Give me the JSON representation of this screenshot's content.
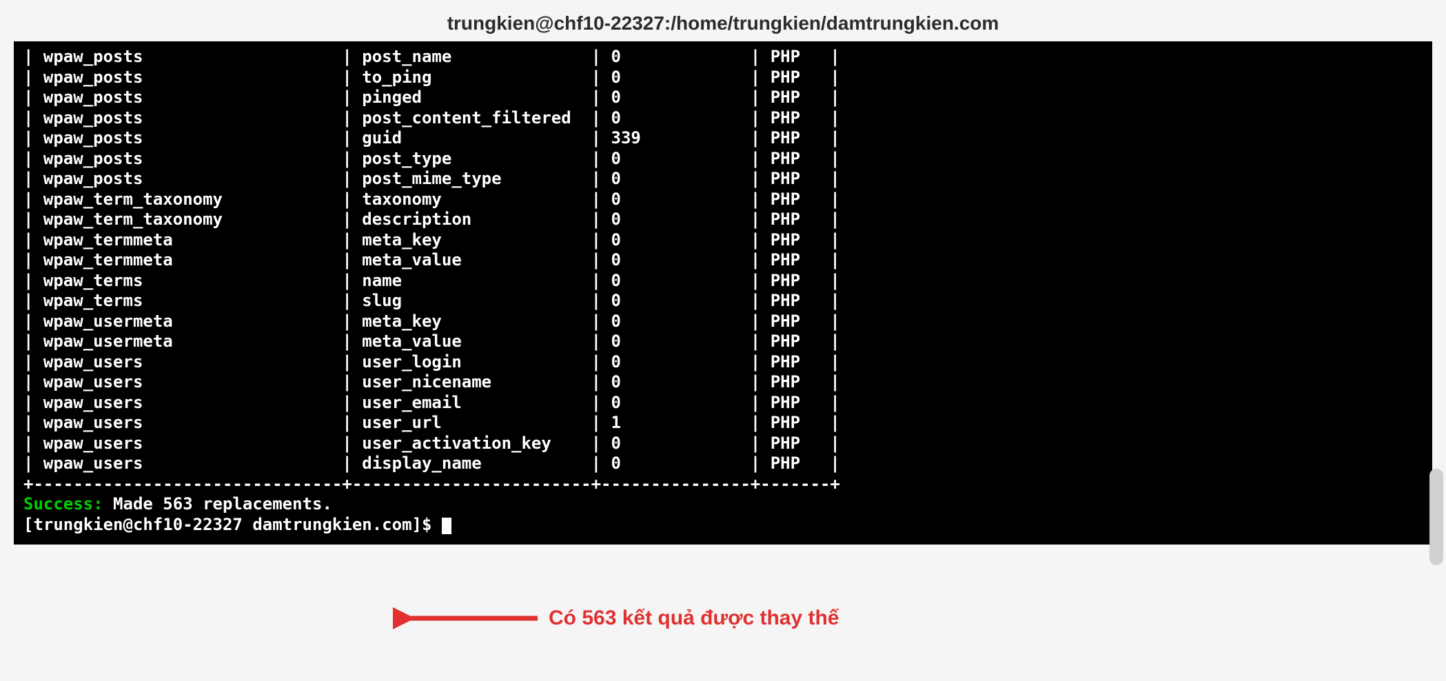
{
  "title": "trungkien@chf10-22327:/home/trungkien/damtrungkien.com",
  "rows": [
    {
      "table": "wpaw_posts",
      "column": "post_name",
      "count": "0",
      "type": "PHP"
    },
    {
      "table": "wpaw_posts",
      "column": "to_ping",
      "count": "0",
      "type": "PHP"
    },
    {
      "table": "wpaw_posts",
      "column": "pinged",
      "count": "0",
      "type": "PHP"
    },
    {
      "table": "wpaw_posts",
      "column": "post_content_filtered",
      "count": "0",
      "type": "PHP"
    },
    {
      "table": "wpaw_posts",
      "column": "guid",
      "count": "339",
      "type": "PHP"
    },
    {
      "table": "wpaw_posts",
      "column": "post_type",
      "count": "0",
      "type": "PHP"
    },
    {
      "table": "wpaw_posts",
      "column": "post_mime_type",
      "count": "0",
      "type": "PHP"
    },
    {
      "table": "wpaw_term_taxonomy",
      "column": "taxonomy",
      "count": "0",
      "type": "PHP"
    },
    {
      "table": "wpaw_term_taxonomy",
      "column": "description",
      "count": "0",
      "type": "PHP"
    },
    {
      "table": "wpaw_termmeta",
      "column": "meta_key",
      "count": "0",
      "type": "PHP"
    },
    {
      "table": "wpaw_termmeta",
      "column": "meta_value",
      "count": "0",
      "type": "PHP"
    },
    {
      "table": "wpaw_terms",
      "column": "name",
      "count": "0",
      "type": "PHP"
    },
    {
      "table": "wpaw_terms",
      "column": "slug",
      "count": "0",
      "type": "PHP"
    },
    {
      "table": "wpaw_usermeta",
      "column": "meta_key",
      "count": "0",
      "type": "PHP"
    },
    {
      "table": "wpaw_usermeta",
      "column": "meta_value",
      "count": "0",
      "type": "PHP"
    },
    {
      "table": "wpaw_users",
      "column": "user_login",
      "count": "0",
      "type": "PHP"
    },
    {
      "table": "wpaw_users",
      "column": "user_nicename",
      "count": "0",
      "type": "PHP"
    },
    {
      "table": "wpaw_users",
      "column": "user_email",
      "count": "0",
      "type": "PHP"
    },
    {
      "table": "wpaw_users",
      "column": "user_url",
      "count": "1",
      "type": "PHP"
    },
    {
      "table": "wpaw_users",
      "column": "user_activation_key",
      "count": "0",
      "type": "PHP"
    },
    {
      "table": "wpaw_users",
      "column": "display_name",
      "count": "0",
      "type": "PHP"
    }
  ],
  "col_widths": {
    "table": 30,
    "column": 23,
    "count": 14,
    "type": 6
  },
  "success_label": "Success:",
  "success_msg": " Made 563 replacements.",
  "prompt": "[trungkien@chf10-22327 damtrungkien.com]$ ",
  "annotation": "Có 563 kết quả được thay thế",
  "colors": {
    "success": "#00d000",
    "annotation": "#e03030"
  }
}
